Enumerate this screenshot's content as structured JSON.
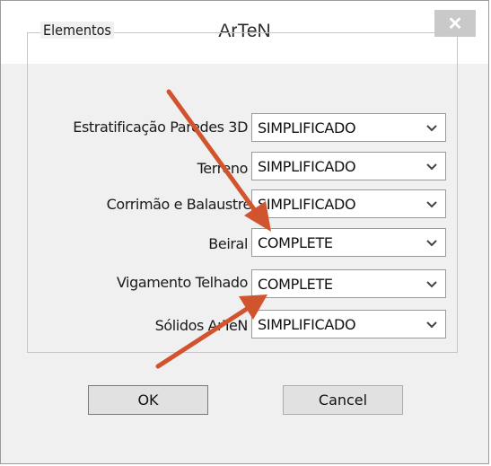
{
  "window": {
    "title": "ArTeN",
    "close_icon": "close-icon"
  },
  "group": {
    "legend": "Elementos",
    "rows": [
      {
        "label": "Estratificação Paredes 3D",
        "value": "SIMPLIFICADO"
      },
      {
        "label": "Terreno",
        "value": "SIMPLIFICADO"
      },
      {
        "label": "Corrimão e Balaustre",
        "value": "SIMPLIFICADO"
      },
      {
        "label": "Beiral",
        "value": "COMPLETE"
      },
      {
        "label": "Vigamento Telhado",
        "value": "COMPLETE"
      },
      {
        "label": "Sólidos ArTeN",
        "value": "SIMPLIFICADO"
      }
    ]
  },
  "buttons": {
    "ok": "OK",
    "cancel": "Cancel"
  },
  "annotation": {
    "arrow_color": "#d2542e"
  }
}
